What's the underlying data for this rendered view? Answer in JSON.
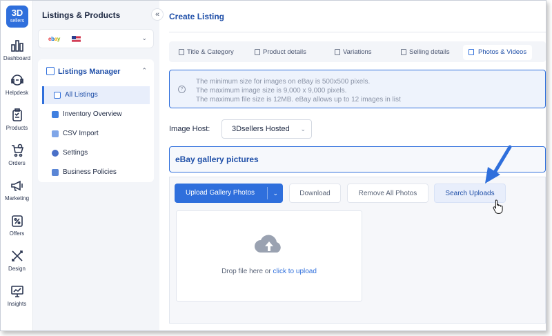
{
  "brand": {
    "logo_line1": "3D",
    "logo_line2": "sellers",
    "accent_color": "#2f6fdc"
  },
  "rail": {
    "items": [
      {
        "label": "Dashboard",
        "icon": "bar-chart-icon"
      },
      {
        "label": "Helpdesk",
        "icon": "headset-icon"
      },
      {
        "label": "Products",
        "icon": "clipboard-check-icon"
      },
      {
        "label": "Orders",
        "icon": "cart-icon"
      },
      {
        "label": "Marketing",
        "icon": "megaphone-icon"
      },
      {
        "label": "Offers",
        "icon": "percent-tag-icon"
      },
      {
        "label": "Design",
        "icon": "pencil-ruler-icon"
      },
      {
        "label": "Insights",
        "icon": "monitor-chart-icon"
      }
    ]
  },
  "sidebar": {
    "title": "Listings & Products",
    "collapse_icon": "double-chevron-left-icon",
    "marketplace": {
      "logo_e": "e",
      "logo_b": "b",
      "logo_a": "a",
      "logo_y": "y",
      "flag": "us-flag-icon"
    },
    "section": {
      "label": "Listings Manager",
      "items": [
        {
          "label": "All Listings",
          "active": true
        },
        {
          "label": "Inventory Overview"
        },
        {
          "label": "CSV Import"
        },
        {
          "label": "Settings"
        },
        {
          "label": "Business Policies"
        }
      ]
    }
  },
  "main": {
    "title": "Create Listing",
    "tabs": [
      {
        "label": "Title & Category"
      },
      {
        "label": "Product details"
      },
      {
        "label": "Variations"
      },
      {
        "label": "Selling details"
      },
      {
        "label": "Photos & Videos",
        "active": true
      }
    ],
    "info": {
      "line1": "The minimum size for images on eBay is 500x500 pixels.",
      "line2": "The maximum image size is 9,000 x 9,000 pixels.",
      "line3": "The maximum file size is 12MB. eBay allows up to 12 images in list"
    },
    "image_host": {
      "label": "Image Host:",
      "value": "3Dsellers Hosted"
    },
    "gallery": {
      "title": "eBay gallery pictures",
      "upload_button": "Upload Gallery Photos",
      "download_button": "Download",
      "remove_button": "Remove All Photos",
      "search_button": "Search Uploads",
      "drop_text": "Drop file here or ",
      "drop_link": "click to upload"
    }
  }
}
